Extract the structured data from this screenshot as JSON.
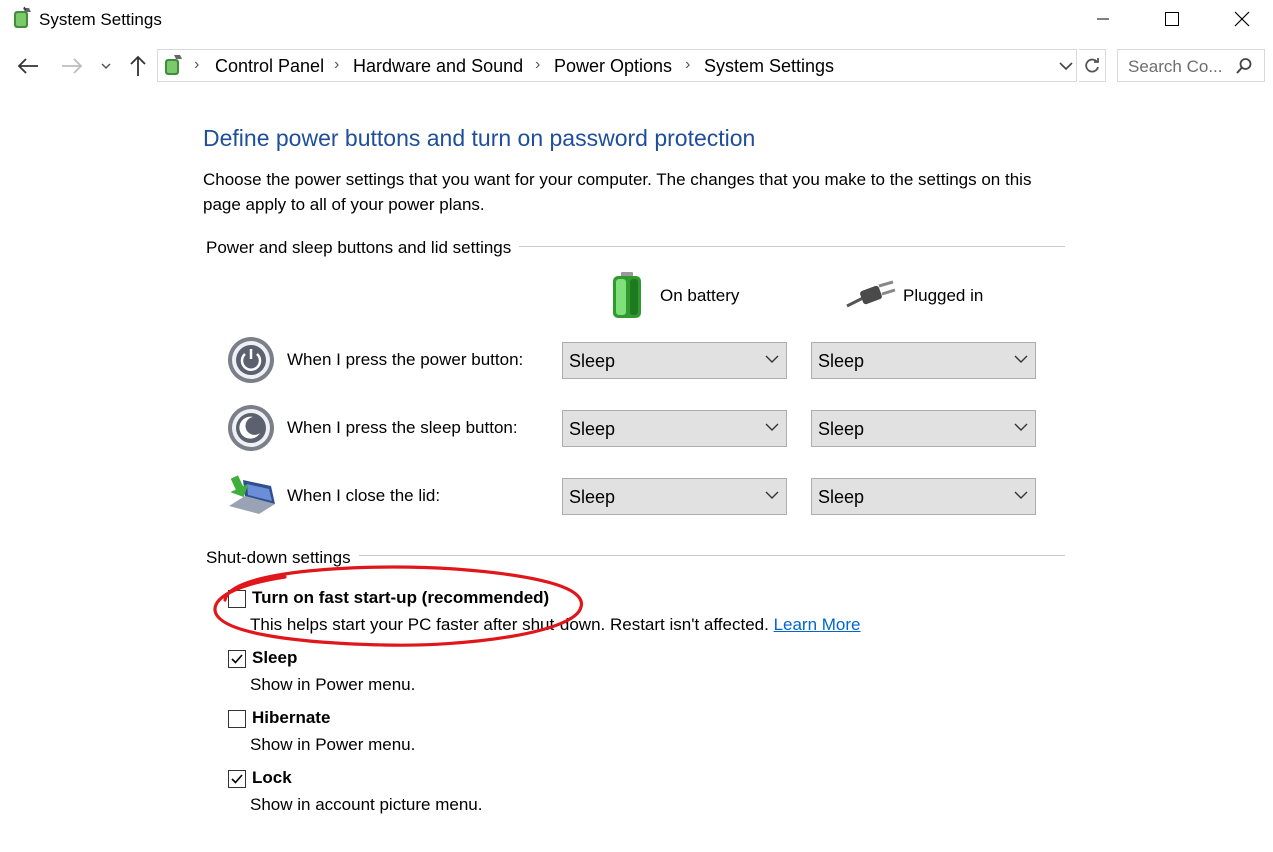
{
  "window": {
    "title": "System Settings",
    "minimize_icon": "minimize-icon",
    "maximize_icon": "maximize-icon",
    "close_icon": "close-icon"
  },
  "nav": {
    "breadcrumbs": [
      "Control Panel",
      "Hardware and Sound",
      "Power Options",
      "System Settings"
    ],
    "search_placeholder": "Search Co..."
  },
  "main": {
    "heading": "Define power buttons and turn on password protection",
    "description": "Choose the power settings that you want for your computer. The changes that you make to the settings on this page apply to all of your power plans.",
    "power_section": {
      "title": "Power and sleep buttons and lid settings",
      "col_battery": "On battery",
      "col_plugged": "Plugged in",
      "rows": [
        {
          "label": "When I press the power button:",
          "battery": "Sleep",
          "plugged": "Sleep"
        },
        {
          "label": "When I press the sleep button:",
          "battery": "Sleep",
          "plugged": "Sleep"
        },
        {
          "label": "When I close the lid:",
          "battery": "Sleep",
          "plugged": "Sleep"
        }
      ]
    },
    "shutdown_section": {
      "title": "Shut-down settings",
      "items": [
        {
          "label": "Turn on fast start-up (recommended)",
          "sub": "This helps start your PC faster after shut-down. Restart isn't affected.",
          "link": "Learn More",
          "checked": false
        },
        {
          "label": "Sleep",
          "sub": "Show in Power menu.",
          "checked": true
        },
        {
          "label": "Hibernate",
          "sub": "Show in Power menu.",
          "checked": false
        },
        {
          "label": "Lock",
          "sub": "Show in account picture menu.",
          "checked": true
        }
      ]
    }
  },
  "colors": {
    "heading": "#1e4e9c",
    "link": "#0066cc",
    "annotation_circle": "#e0161b"
  }
}
